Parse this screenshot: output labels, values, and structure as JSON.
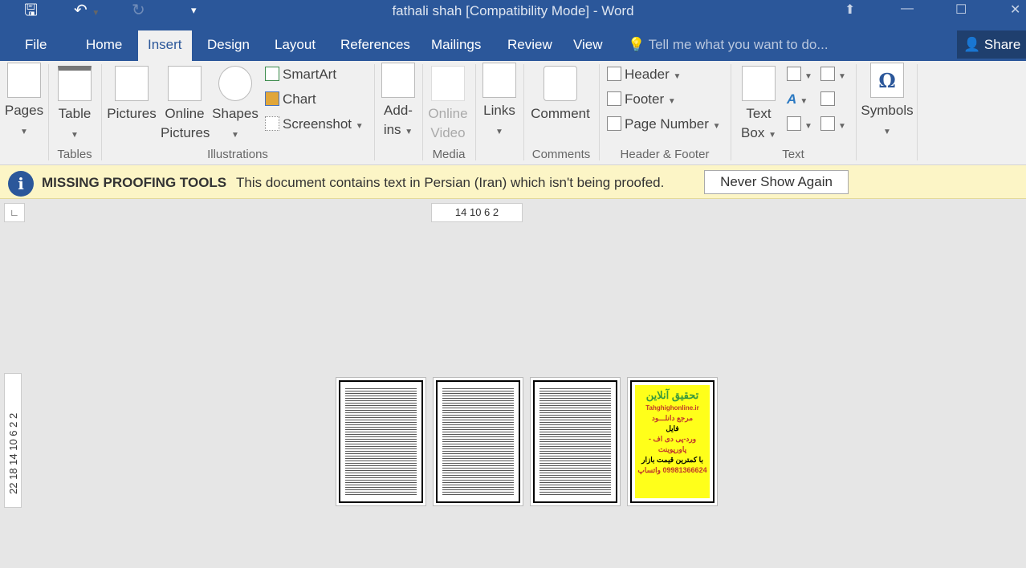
{
  "titlebar": {
    "title": "fathali shah [Compatibility Mode] - Word",
    "qat": {
      "save": "save-icon",
      "undo": "undo-icon",
      "redo": "redo-icon",
      "customize": "customize-icon"
    }
  },
  "tabs": [
    {
      "label": "File"
    },
    {
      "label": "Home"
    },
    {
      "label": "Insert",
      "active": true
    },
    {
      "label": "Design"
    },
    {
      "label": "Layout"
    },
    {
      "label": "References"
    },
    {
      "label": "Mailings"
    },
    {
      "label": "Review"
    },
    {
      "label": "View"
    }
  ],
  "tell_me": "Tell me what you want to do...",
  "share": "Share",
  "ribbon": {
    "pages": "Pages",
    "table": "Table",
    "pictures": "Pictures",
    "online_pictures_1": "Online",
    "online_pictures_2": "Pictures",
    "shapes": "Shapes",
    "smartart": "SmartArt",
    "chart": "Chart",
    "screenshot": "Screenshot",
    "addins_1": "Add-",
    "addins_2": "ins",
    "online_video_1": "Online",
    "online_video_2": "Video",
    "links": "Links",
    "comment": "Comment",
    "header": "Header",
    "footer": "Footer",
    "page_number": "Page Number",
    "text_box_1": "Text",
    "text_box_2": "Box",
    "symbols": "Symbols",
    "groups": {
      "tables": "Tables",
      "illustrations": "Illustrations",
      "media": "Media",
      "comments": "Comments",
      "header_footer": "Header & Footer",
      "text": "Text"
    }
  },
  "message": {
    "title": "MISSING PROOFING TOOLS",
    "text": "This document contains text in Persian (Iran) which isn't being proofed.",
    "button": "Never Show Again"
  },
  "rulers": {
    "horizontal": "14 10  6   2",
    "vertical": "22 18 14 10  6   2      2"
  },
  "ad": {
    "l1": "تحقیق آنلاین",
    "l2": "Tahghighonline.ir",
    "l3": "مرجع دانلـــود",
    "l4": "فایل",
    "l5": "ورد-پی دی اف - پاورپوینت",
    "l6": "با کمترین قیمت بازار",
    "l7": "09981366624 واتساپ"
  },
  "colors": {
    "brand": "#2b579a",
    "message_bar": "#fcf5c6"
  }
}
